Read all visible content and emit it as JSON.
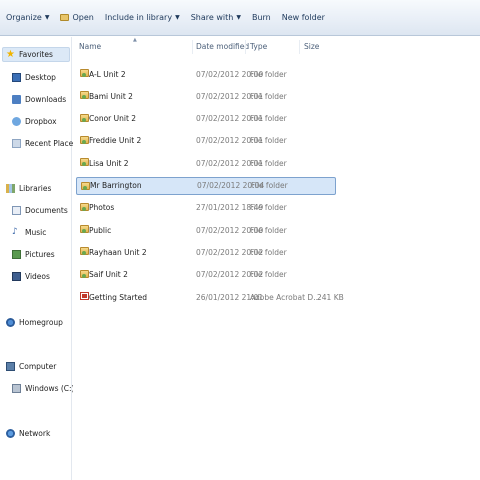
{
  "toolbar": {
    "organize": "Organize",
    "open": "Open",
    "include_in_library": "Include in library",
    "share_with": "Share with",
    "burn": "Burn",
    "new_folder": "New folder"
  },
  "columns": {
    "name": "Name",
    "date_modified": "Date modified",
    "type": "Type",
    "size": "Size"
  },
  "nav": {
    "favorites": "Favorites",
    "desktop": "Desktop",
    "downloads": "Downloads",
    "dropbox": "Dropbox",
    "recent_places": "Recent Places",
    "libraries": "Libraries",
    "documents": "Documents",
    "music": "Music",
    "pictures": "Pictures",
    "videos": "Videos",
    "homegroup": "Homegroup",
    "computer": "Computer",
    "windows_c": "Windows (C:)",
    "network": "Network"
  },
  "files": [
    {
      "name": "A-L Unit 2",
      "date": "07/02/2012 20:00",
      "type": "File folder",
      "size": ""
    },
    {
      "name": "Bami Unit 2",
      "date": "07/02/2012 20:01",
      "type": "File folder",
      "size": ""
    },
    {
      "name": "Conor Unit 2",
      "date": "07/02/2012 20:01",
      "type": "File folder",
      "size": ""
    },
    {
      "name": "Freddie Unit 2",
      "date": "07/02/2012 20:01",
      "type": "File folder",
      "size": ""
    },
    {
      "name": "Lisa Unit 2",
      "date": "07/02/2012 20:01",
      "type": "File folder",
      "size": ""
    },
    {
      "name": "Mr Barrington",
      "date": "07/02/2012 20:04",
      "type": "File folder",
      "size": "",
      "selected": true
    },
    {
      "name": "Photos",
      "date": "27/01/2012 18:49",
      "type": "File folder",
      "size": ""
    },
    {
      "name": "Public",
      "date": "07/02/2012 20:00",
      "type": "File folder",
      "size": ""
    },
    {
      "name": "Rayhaan Unit 2",
      "date": "07/02/2012 20:02",
      "type": "File folder",
      "size": ""
    },
    {
      "name": "Saif Unit 2",
      "date": "07/02/2012 20:02",
      "type": "File folder",
      "size": ""
    },
    {
      "name": "Getting Started",
      "date": "26/01/2012 21:01",
      "type": "Adobe Acrobat D...",
      "size": "241 KB"
    }
  ]
}
